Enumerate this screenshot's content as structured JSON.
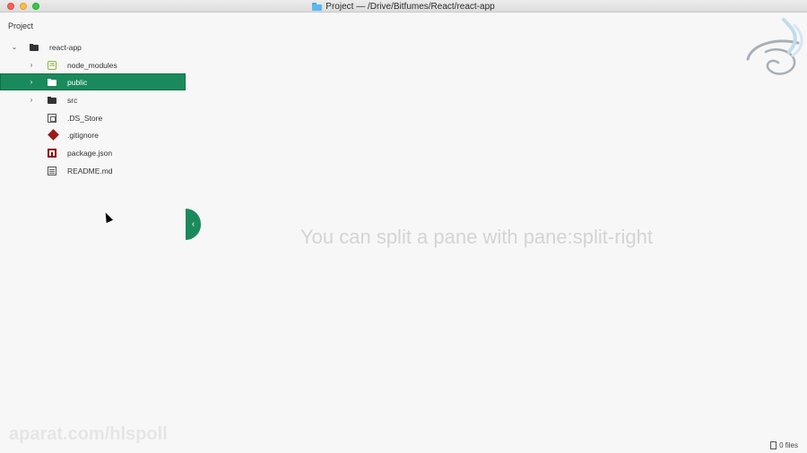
{
  "window": {
    "title": "Project — /Drive/Bitfumes/React/react-app"
  },
  "tree_view": {
    "panel_title": "Project",
    "root": {
      "label": "react-app",
      "expanded": true
    },
    "items": [
      {
        "label": "node_modules",
        "type": "folder",
        "icon": "nodejs-folder-icon",
        "expandable": true
      },
      {
        "label": "public",
        "type": "folder",
        "icon": "folder-icon",
        "expandable": true,
        "selected": true
      },
      {
        "label": "src",
        "type": "folder",
        "icon": "folder-icon",
        "expandable": true
      },
      {
        "label": ".DS_Store",
        "type": "file",
        "icon": "binary-file-icon"
      },
      {
        "label": ".gitignore",
        "type": "file",
        "icon": "git-icon"
      },
      {
        "label": "package.json",
        "type": "file",
        "icon": "npm-icon"
      },
      {
        "label": "README.md",
        "type": "file",
        "icon": "markdown-icon"
      }
    ]
  },
  "editor": {
    "hint": "You can split a pane with pane:split-right"
  },
  "status_bar": {
    "files": "0 files"
  },
  "watermark": {
    "text": "aparat.com/hlspoll"
  },
  "colors": {
    "accent": "#1a8a5c",
    "hint_text": "#d4d4d4"
  }
}
